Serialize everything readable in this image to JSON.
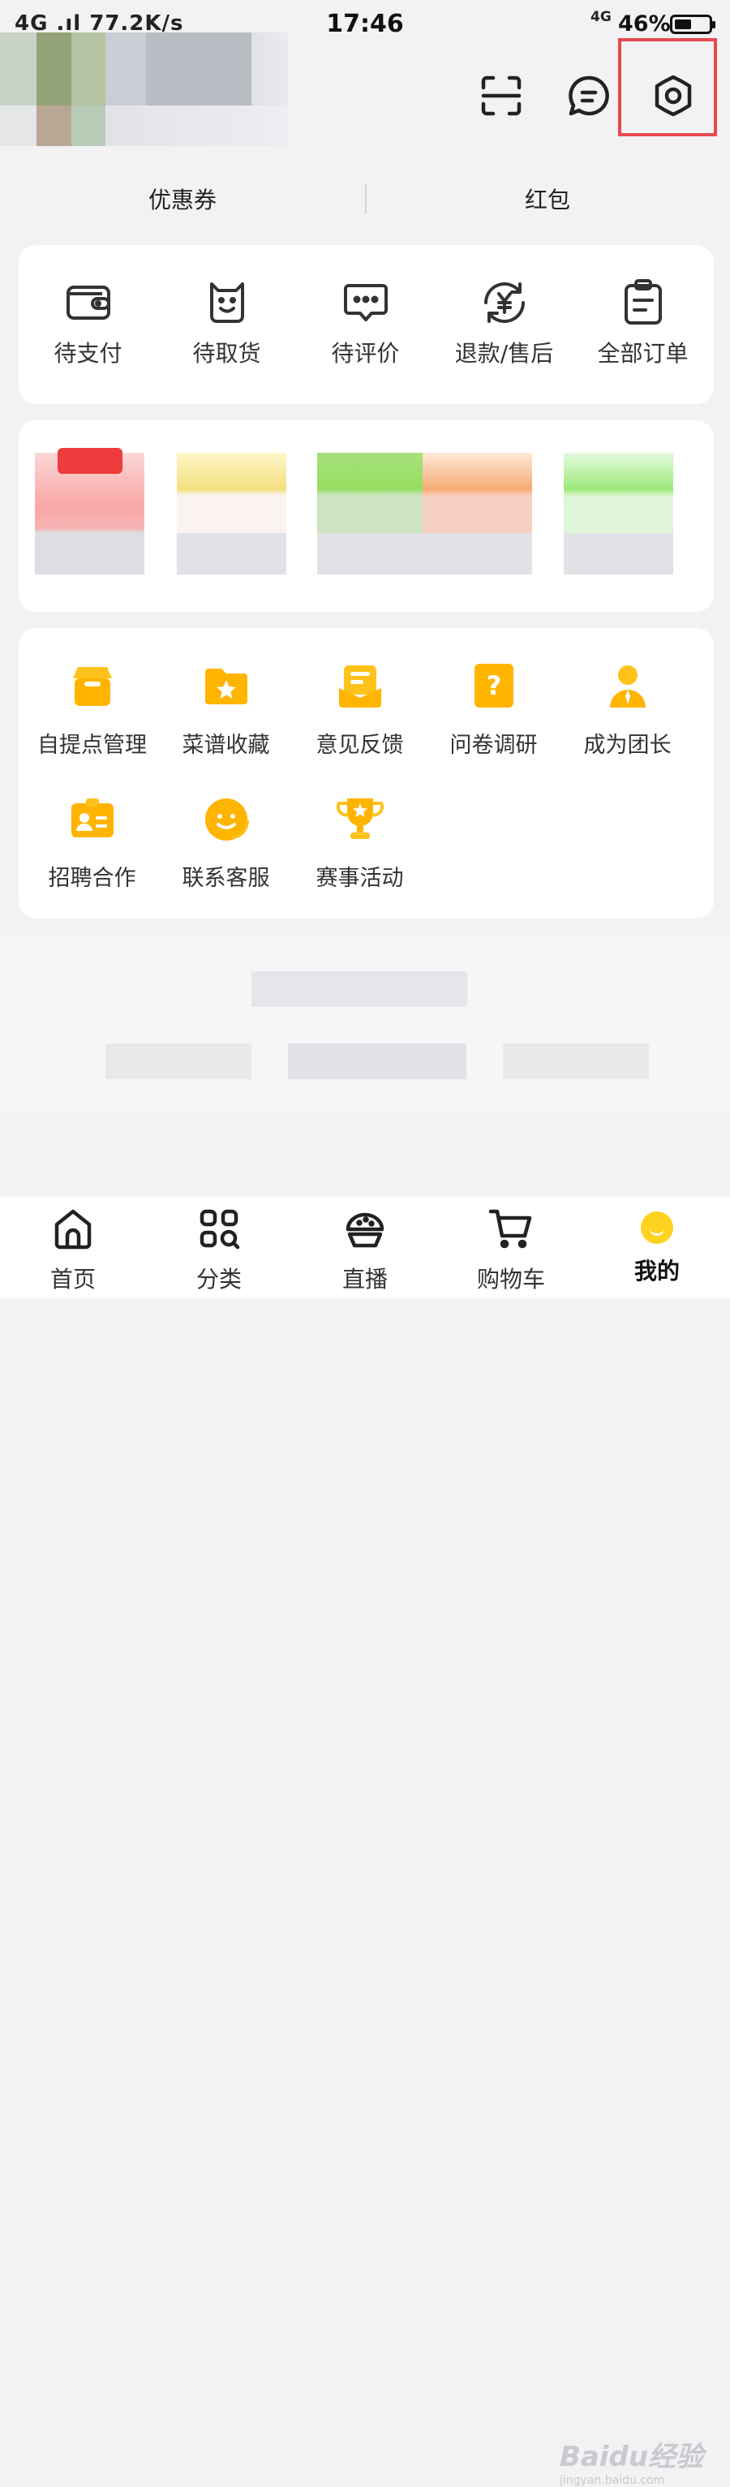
{
  "status_bar": {
    "left_text": "4G .ıl 77.2K/s",
    "time": "17:46",
    "network": "4G",
    "battery_percent": "46%",
    "battery_level": 0.46
  },
  "header": {
    "icons": [
      "scan-icon",
      "message-icon",
      "settings-icon"
    ],
    "highlight_color": "#e8484f"
  },
  "coupons": {
    "left_label": "优惠券",
    "right_label": "红包"
  },
  "orders": {
    "items": [
      {
        "label": "待支付",
        "icon": "wallet-icon"
      },
      {
        "label": "待取货",
        "icon": "bag-icon"
      },
      {
        "label": "待评价",
        "icon": "comment-icon"
      },
      {
        "label": "退款/售后",
        "icon": "refund-icon"
      },
      {
        "label": "全部订单",
        "icon": "clipboard-icon"
      }
    ]
  },
  "services": {
    "accent_color": "#ffb400",
    "items": [
      {
        "label": "自提点管理",
        "icon": "store-icon"
      },
      {
        "label": "菜谱收藏",
        "icon": "folder-star-icon"
      },
      {
        "label": "意见反馈",
        "icon": "feedback-icon"
      },
      {
        "label": "问卷调研",
        "icon": "question-icon"
      },
      {
        "label": "成为团长",
        "icon": "leader-icon"
      },
      {
        "label": "招聘合作",
        "icon": "id-card-icon"
      },
      {
        "label": "联系客服",
        "icon": "headset-icon"
      },
      {
        "label": "赛事活动",
        "icon": "trophy-icon"
      }
    ]
  },
  "tab_bar": {
    "items": [
      {
        "label": "首页",
        "icon": "home-icon"
      },
      {
        "label": "分类",
        "icon": "category-icon"
      },
      {
        "label": "直播",
        "icon": "live-icon"
      },
      {
        "label": "购物车",
        "icon": "cart-icon"
      },
      {
        "label": "我的",
        "icon": "me-icon"
      }
    ],
    "active_index": 4
  },
  "watermark": {
    "text": "Baidu经验",
    "sub": "jingyan.baidu.com"
  }
}
